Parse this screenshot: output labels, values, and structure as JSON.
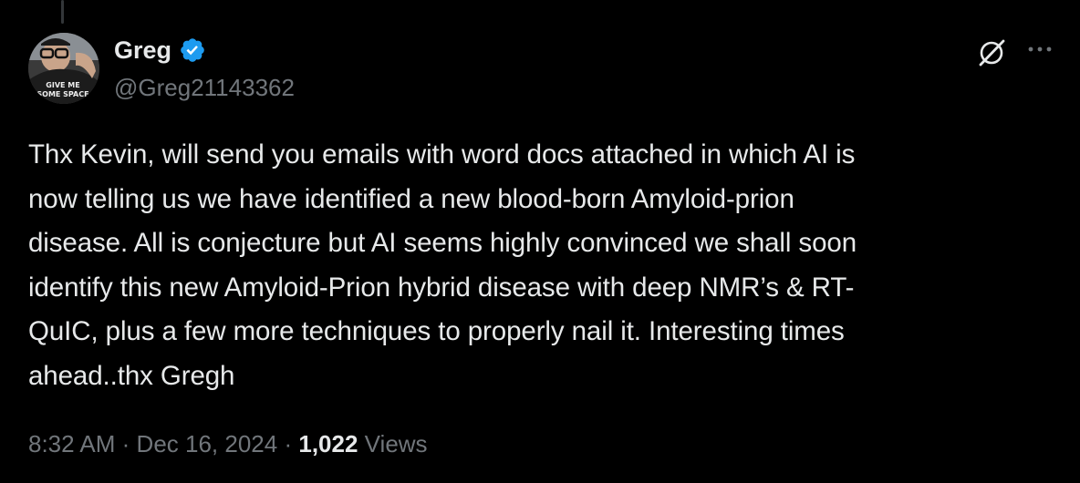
{
  "colors": {
    "background": "#000000",
    "text_primary": "#e7e9ea",
    "text_secondary": "#71767b",
    "verified_blue": "#1d9bf0"
  },
  "author": {
    "display_name": "Greg",
    "handle": "@Greg21143362",
    "verified": true,
    "avatar_shirt_text": [
      "GIVE ME",
      "SOME SPACE"
    ]
  },
  "header_icons": {
    "grok": "grok-icon",
    "more": "more-icon"
  },
  "tweet": {
    "lines": [
      "Thx Kevin, will send you emails with word docs attached in which AI is",
      "now telling us we have identified a new blood-born Amyloid-prion",
      "disease. All is conjecture but AI seems highly convinced we shall soon",
      "identify this new Amyloid-Prion hybrid disease with deep NMR’s & RT-",
      "QuIC, plus a few more techniques to properly nail it. Interesting times",
      "ahead..thx Gregh"
    ]
  },
  "meta": {
    "time": "8:32 AM",
    "separator": "·",
    "date": "Dec 16, 2024",
    "views_count": "1,022",
    "views_label": "Views"
  }
}
